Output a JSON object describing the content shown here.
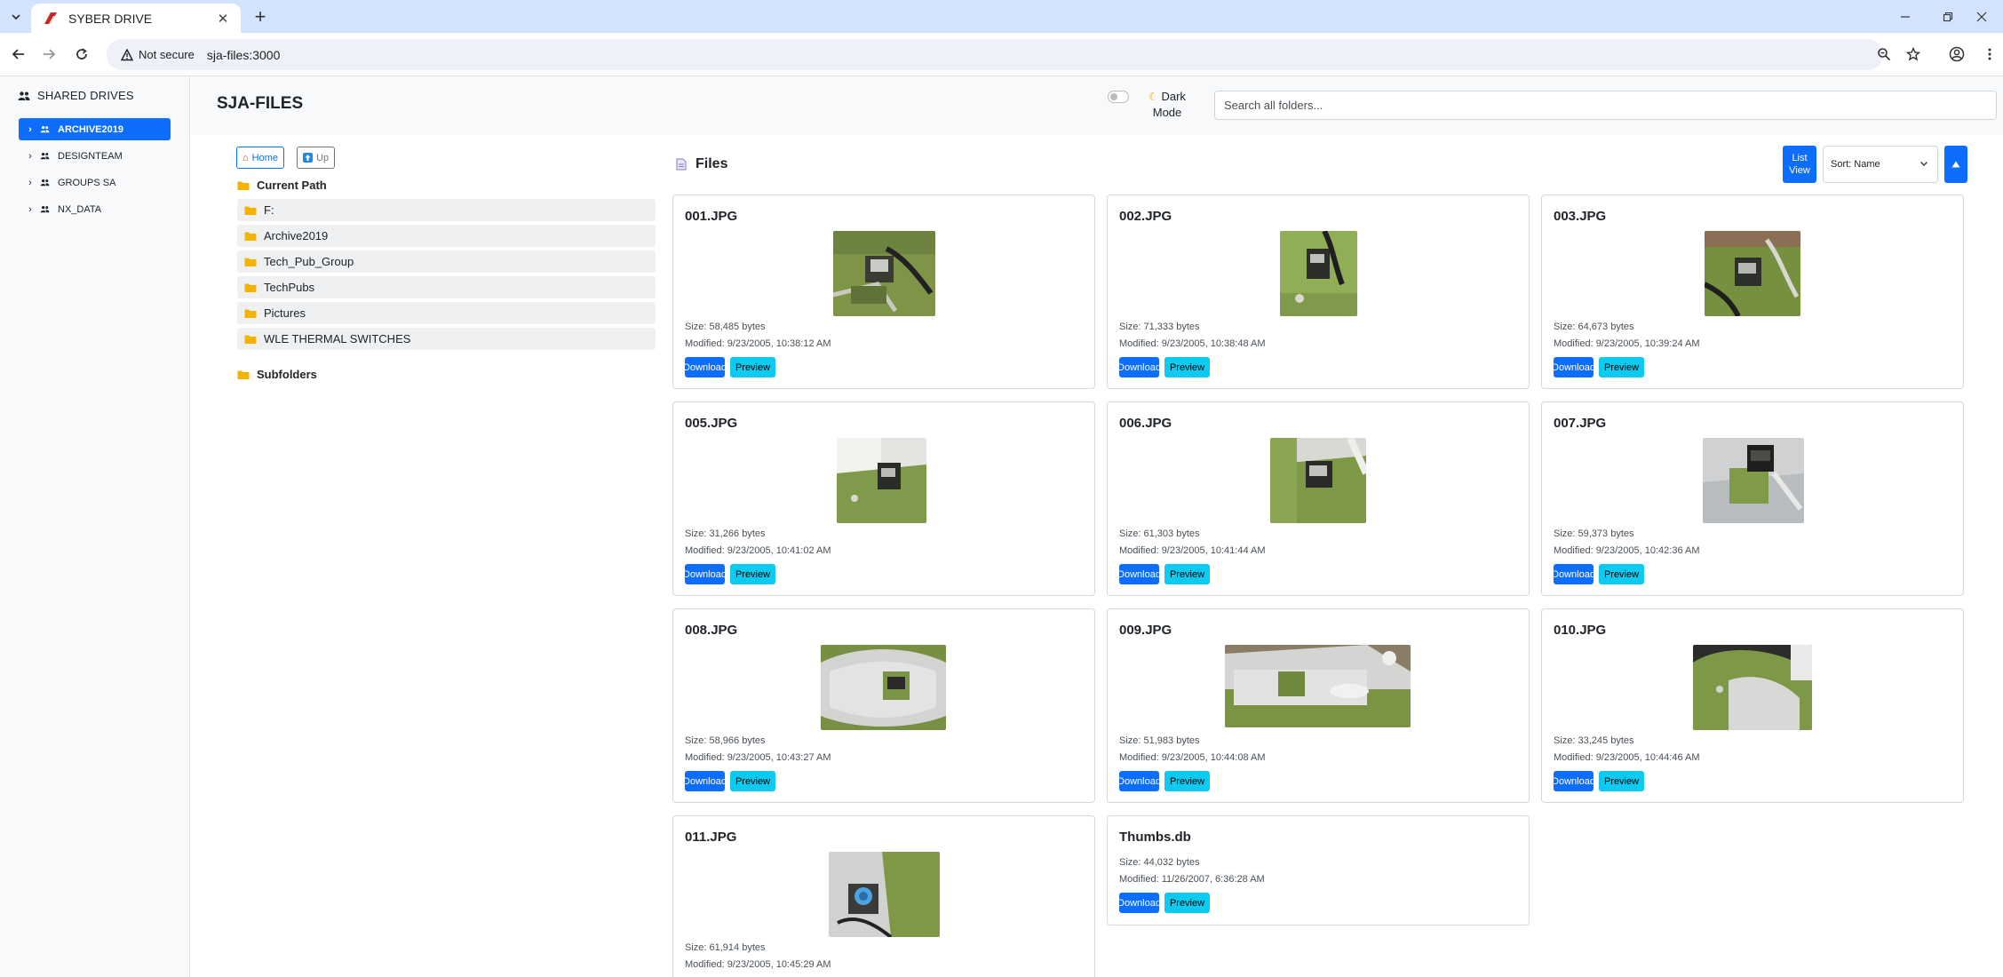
{
  "browser": {
    "tab_title": "SYBER DRIVE",
    "security_label": "Not secure",
    "url": "sja-files:3000"
  },
  "sidebar": {
    "heading": "SHARED DRIVES",
    "drives": [
      {
        "label": "ARCHIVE2019",
        "active": true
      },
      {
        "label": "DESIGNTEAM",
        "active": false
      },
      {
        "label": "GROUPS SA",
        "active": false
      },
      {
        "label": "NX_DATA",
        "active": false
      }
    ]
  },
  "header": {
    "title": "SJA-FILES",
    "dark_mode_label": "Dark Mode",
    "dark_mode_on": false,
    "search_placeholder": "Search all folders..."
  },
  "nav": {
    "home_label": "Home",
    "up_label": "Up",
    "current_path_heading": "Current Path",
    "path_items": [
      "F:",
      "Archive2019",
      "Tech_Pub_Group",
      "TechPubs",
      "Pictures",
      "WLE THERMAL SWITCHES"
    ],
    "subfolders_heading": "Subfolders"
  },
  "files": {
    "heading": "Files",
    "list_view_label": "List View",
    "sort_label": "Sort: Name",
    "download_label": "Download",
    "preview_label": "Preview",
    "items": [
      {
        "name": "001.JPG",
        "size": "Size: 58,485 bytes",
        "modified": "Modified: 9/23/2005, 10:38:12 AM"
      },
      {
        "name": "002.JPG",
        "size": "Size: 71,333 bytes",
        "modified": "Modified: 9/23/2005, 10:38:48 AM"
      },
      {
        "name": "003.JPG",
        "size": "Size: 64,673 bytes",
        "modified": "Modified: 9/23/2005, 10:39:24 AM"
      },
      {
        "name": "005.JPG",
        "size": "Size: 31,266 bytes",
        "modified": "Modified: 9/23/2005, 10:41:02 AM"
      },
      {
        "name": "006.JPG",
        "size": "Size: 61,303 bytes",
        "modified": "Modified: 9/23/2005, 10:41:44 AM"
      },
      {
        "name": "007.JPG",
        "size": "Size: 59,373 bytes",
        "modified": "Modified: 9/23/2005, 10:42:36 AM"
      },
      {
        "name": "008.JPG",
        "size": "Size: 58,966 bytes",
        "modified": "Modified: 9/23/2005, 10:43:27 AM"
      },
      {
        "name": "009.JPG",
        "size": "Size: 51,983 bytes",
        "modified": "Modified: 9/23/2005, 10:44:08 AM"
      },
      {
        "name": "010.JPG",
        "size": "Size: 33,245 bytes",
        "modified": "Modified: 9/23/2005, 10:44:46 AM"
      },
      {
        "name": "011.JPG",
        "size": "Size: 61,914 bytes",
        "modified": "Modified: 9/23/2005, 10:45:29 AM"
      },
      {
        "name": "Thumbs.db",
        "size": "Size: 44,032 bytes",
        "modified": "Modified: 11/26/2007, 6:36:28 AM"
      }
    ]
  }
}
